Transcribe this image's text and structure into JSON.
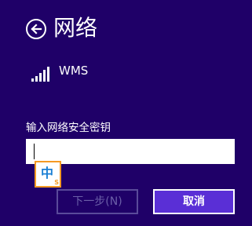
{
  "header": {
    "title": "网络"
  },
  "network": {
    "name": "WMS",
    "icon": "wifi-signal-icon"
  },
  "security_key": {
    "label": "输入网络安全密钥",
    "value": "",
    "placeholder": ""
  },
  "ime": {
    "mode_char": "中",
    "sub_char": "S",
    "icon": "ime-mode-icon"
  },
  "buttons": {
    "next_label": "下一步(N)",
    "cancel_label": "取消"
  },
  "colors": {
    "background": "#1f0068",
    "cancel_button": "#5a2fd6",
    "ime_border": "#f59a23",
    "ime_char": "#1a7fd4"
  }
}
